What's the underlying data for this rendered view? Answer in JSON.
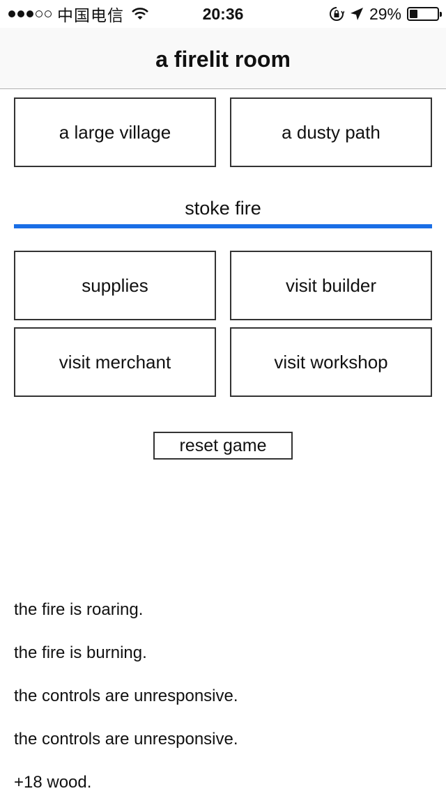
{
  "status_bar": {
    "carrier": "中国电信",
    "signal_bars_filled": 3,
    "signal_bars_total": 5,
    "time": "20:36",
    "battery_percent_text": "29%",
    "battery_level": 0.29,
    "icons": [
      "wifi-icon",
      "orientation-lock-icon",
      "location-arrow-icon",
      "battery-icon"
    ]
  },
  "nav": {
    "title": "a firelit room"
  },
  "locations": [
    {
      "label": "a large village"
    },
    {
      "label": "a dusty path"
    }
  ],
  "stoke": {
    "label": "stoke fire",
    "progress": 1.0,
    "accent": "#1a6ee6"
  },
  "actions": [
    {
      "label": "supplies"
    },
    {
      "label": "visit builder"
    },
    {
      "label": "visit merchant"
    },
    {
      "label": "visit workshop"
    }
  ],
  "reset": {
    "label": "reset game"
  },
  "log": [
    "the fire is roaring.",
    "the fire is burning.",
    "the controls are unresponsive.",
    "the controls are unresponsive.",
    "+18 wood."
  ]
}
